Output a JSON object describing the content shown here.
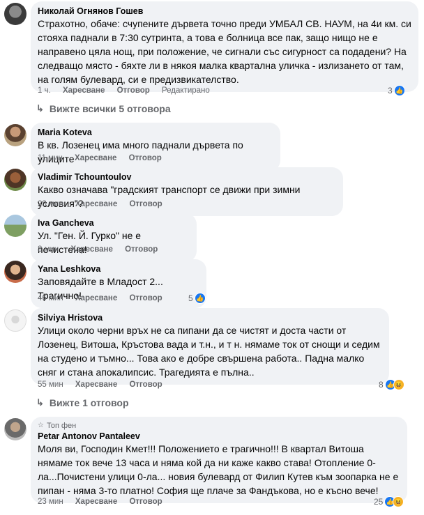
{
  "comments": [
    {
      "author": "Николай Огнянов Гошев",
      "text": "Страхотно, обаче: счупените дървета точно преди УМБАЛ СВ. НАУМ, на 4и км. си стояха паднали в 7:30 сутринта, а това е болница все пак, защо нищо не е направено цяла нощ, при положение, че сигнали със сигурност са подадени? На следващо място - бяхте ли в някоя малка квартална уличка - излизането от там, на голям булевард, си е предизвикателство.",
      "time": "1 ч.",
      "like_label": "Харесване",
      "reply_label": "Отговор",
      "edited_label": "Редактирано",
      "reactions": "3"
    },
    {
      "author": "Maria Koteva",
      "text": "В кв. Лозенец има много паднали дървета по улиците",
      "time": "11 мин",
      "like_label": "Харесване",
      "reply_label": "Отговор"
    },
    {
      "author": "Vladimir Tchountoulov",
      "text": "Какво означава \"градският транспорт се движи при зимни условия\"?",
      "time": "23 мин",
      "like_label": "Харесване",
      "reply_label": "Отговор"
    },
    {
      "author": "Iva Gancheva",
      "text": "Ул. \"Ген. Й. Гурко\" не е почистена!",
      "time": "8 мин",
      "like_label": "Харесване",
      "reply_label": "Отговор"
    },
    {
      "author": "Yana Leshkova",
      "text": "Заповядайте в Младост 2... Трагично!",
      "time": "46 мин",
      "like_label": "Харесване",
      "reply_label": "Отговор",
      "reactions": "5"
    },
    {
      "author": "Silviya Hristova",
      "text": "Улици около черни връх не са пипани да се чистят и доста части от Лозенец, Витоша, Кръстова вада и т.н., и т н. нямаме ток от снощи и седим на студено и тъмно... Това ако е добре свършена работа.. Падна малко сняг и стана апокалипсис. Трагедията е пълна..",
      "time": "55 мин",
      "like_label": "Харесване",
      "reply_label": "Отговор",
      "reactions": "8"
    },
    {
      "author": "Petar Antonov Pantaleev",
      "badge": "Топ фен",
      "text": "Моля ви, Господин Кмет!!! Положението е трагично!!! В квартал Витоша нямаме ток вече 13 часа и няма кой да ни каже какво става! Отопление 0-ла...Почистени улици 0-ла... новия булевард от Филип Кутев към зоопарка не е пипан - няма 3-то платно! София ще плаче за Фандъкова, но е късно вече!",
      "time": "23 мин",
      "like_label": "Харесване",
      "reply_label": "Отговор",
      "reactions": "25"
    }
  ],
  "view_all_replies": "Вижте всички 5 отговора",
  "view_one_reply": "Вижте 1 отговор",
  "icons": {
    "reply_arrow": "reply-arrow-icon",
    "like": "like-icon",
    "haha": "haha-icon"
  }
}
